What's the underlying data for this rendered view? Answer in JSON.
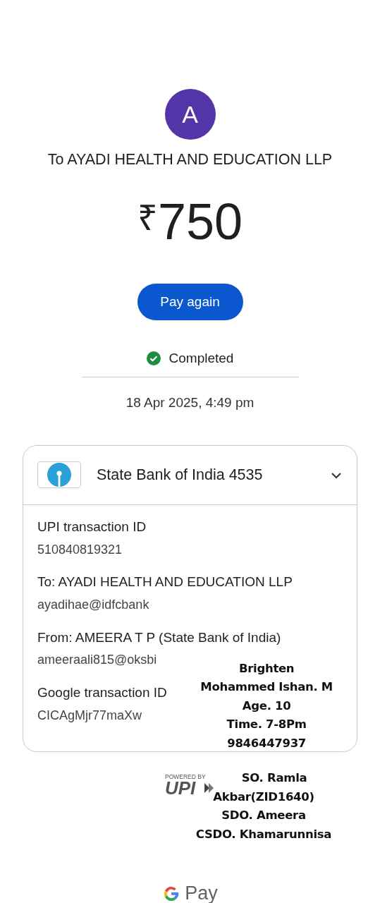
{
  "payee": {
    "avatar_letter": "A",
    "title": "To AYADI HEALTH AND EDUCATION LLP"
  },
  "amount": {
    "currency": "₹",
    "value": "750"
  },
  "pay_again_button": "Pay again",
  "status": {
    "kind": "completed",
    "label": "Completed"
  },
  "date": "18 Apr 2025, 4:49 pm",
  "details_card": {
    "bank": "State Bank of India 4535",
    "expanded": true,
    "rows": [
      {
        "label": "UPI transaction ID",
        "value": "510840819321"
      },
      {
        "label": "To: AYADI HEALTH AND EDUCATION LLP",
        "value": "ayadihae@idfcbank"
      },
      {
        "label": "From: AMEERA  T P (State Bank of India)",
        "value": "ameeraali815@oksbi"
      },
      {
        "label": "Google transaction ID",
        "value": "CICAgMjr77maXw"
      }
    ]
  },
  "overlay_note_card": [
    "Brighten",
    "Mohammed Ishan. M",
    "Age. 10",
    "Time. 7-8Pm",
    "9846447937"
  ],
  "upi_logo": {
    "caption": "POWERED BY",
    "mark": "UPI"
  },
  "overlay_note_footer": [
    "SO. Ramla",
    "Akbar(ZID1640)",
    "SDO. Ameera",
    "CSDO. Khamarunnisa"
  ],
  "gpay_logo": {
    "text": "Pay"
  }
}
